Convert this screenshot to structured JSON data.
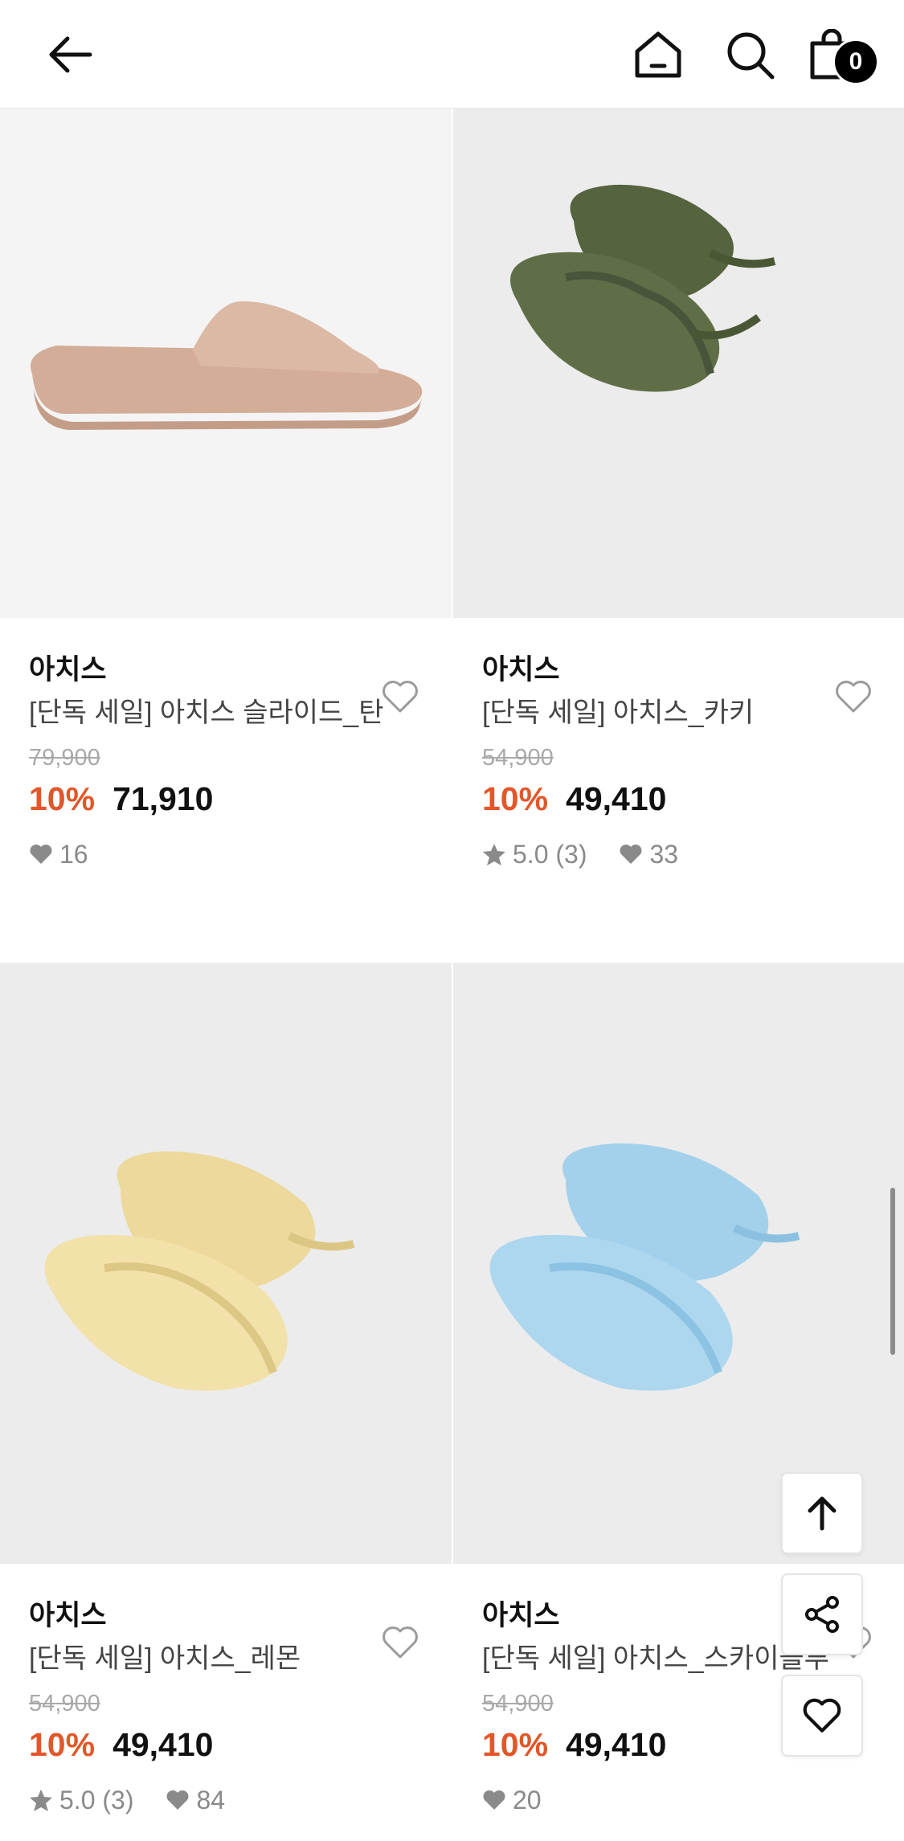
{
  "header": {
    "cart_count": "0"
  },
  "products": [
    {
      "brand": "아치스",
      "name": "[단독 세일] 아치스 슬라이드_탄",
      "original_price": "79,900",
      "discount": "10%",
      "price": "71,910",
      "rating": "",
      "likes": "16",
      "image": "tan-slide-sandal",
      "color": "#d7b5a2"
    },
    {
      "brand": "아치스",
      "name": "[단독 세일] 아치스_카키",
      "original_price": "54,900",
      "discount": "10%",
      "price": "49,410",
      "rating": "5.0 (3)",
      "likes": "33",
      "image": "khaki-flip-flops",
      "color": "#5c6b45"
    },
    {
      "brand": "아치스",
      "name": "[단독 세일] 아치스_레몬",
      "original_price": "54,900",
      "discount": "10%",
      "price": "49,410",
      "rating": "5.0 (3)",
      "likes": "84",
      "image": "lemon-flip-flops",
      "color": "#efde9e"
    },
    {
      "brand": "아치스",
      "name": "[단독 세일] 아치스_스카이블루",
      "original_price": "54,900",
      "discount": "10%",
      "price": "49,410",
      "rating": "",
      "likes": "20",
      "image": "skyblue-flip-flops",
      "color": "#aad6ee"
    }
  ],
  "colors": {
    "accent_discount": "#e2572a",
    "meta_gray": "#8a8a8a"
  }
}
